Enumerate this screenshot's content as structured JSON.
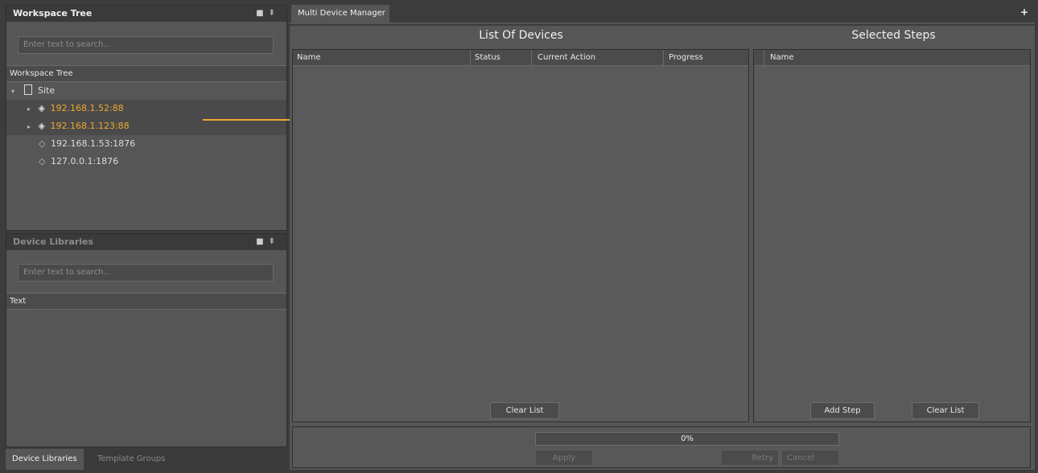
{
  "workspace": {
    "title": "Workspace Tree",
    "search_placeholder": "Enter text to search...",
    "column": "Workspace Tree",
    "site_label": "Site",
    "devices": [
      {
        "label": "192.168.1.52:88",
        "highlight": true
      },
      {
        "label": "192.168.1.123:88",
        "highlight": true
      },
      {
        "label": "192.168.1.53:1876",
        "highlight": false
      },
      {
        "label": "127.0.0.1:1876",
        "highlight": false
      }
    ]
  },
  "libraries": {
    "title": "Device Libraries",
    "search_placeholder": "Enter text to search...",
    "column": "Text"
  },
  "bottom_tabs": [
    "Device Libraries",
    "Template Groups"
  ],
  "manager": {
    "tab_label": "Multi Device Manager",
    "tab_close": "✕",
    "add_tab": "+",
    "list_title": "List Of Devices",
    "list_columns": [
      "Name",
      "Status",
      "Current Action",
      "Progress"
    ],
    "list_clear": "Clear List",
    "steps_title": "Selected Steps",
    "steps_column": "Name",
    "add_step": "Add Step",
    "steps_clear": "Clear List",
    "progress_text": "0%",
    "progress_value": 0,
    "apply": "Apply",
    "retry": "Retry",
    "cancel": "Cancel"
  },
  "colors": {
    "accent": "#f0a830",
    "panel": "#565656",
    "title_bar": "#3a3a3a"
  },
  "panel_controls": "▫ ⇞"
}
